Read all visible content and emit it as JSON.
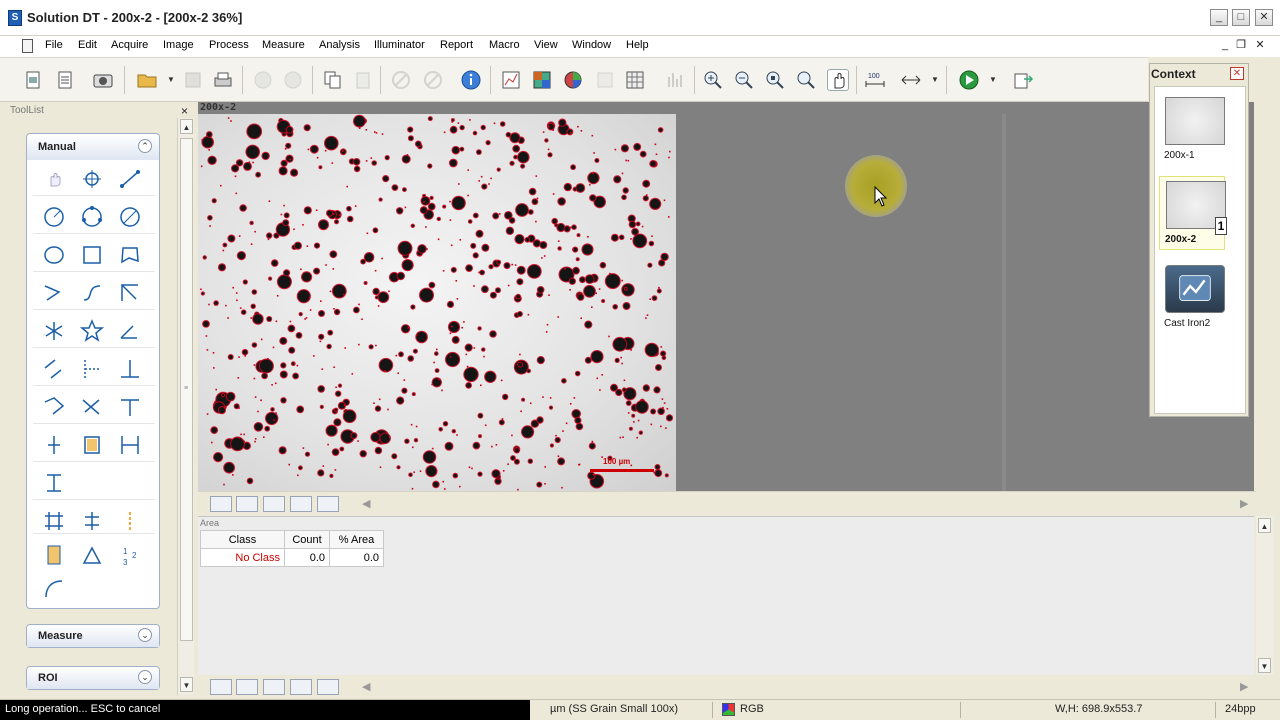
{
  "window": {
    "title": "Solution DT - 200x-2 - [200x-2 36%]",
    "app_icon": "app-logo-icon",
    "controls": {
      "minimize": "_",
      "maximize": "□",
      "close": "✕"
    }
  },
  "menu": {
    "items": [
      "File",
      "Edit",
      "Acquire",
      "Image",
      "Process",
      "Measure",
      "Analysis",
      "Illuminator",
      "Report",
      "Macro",
      "View",
      "Window",
      "Help"
    ],
    "mdi_controls": {
      "minimize": "_",
      "restore": "❐",
      "close": "✕"
    }
  },
  "toolbar": {
    "buttons": [
      "new-image-icon",
      "new-report-icon",
      "camera-icon",
      "open-folder-icon",
      "save-icon",
      "print-icon",
      "undo-icon",
      "redo-icon",
      "copy-icon",
      "paste-icon",
      "cancel-icon",
      "stop-icon",
      "info-icon",
      "image-stats-icon",
      "classify-icon",
      "phase-icon",
      "blank-icon",
      "grid-icon",
      "histogram-icon",
      "zoom-in-icon",
      "zoom-out-icon",
      "zoom-fit-icon",
      "zoom-area-icon",
      "hand-pan-icon",
      "scale-bar-icon",
      "calibration-icon",
      "run-macro-icon",
      "export-icon"
    ]
  },
  "toollist": {
    "title": "ToolList",
    "close": "×",
    "groups": [
      {
        "title": "Manual",
        "expanded": true,
        "chevron": "⌃"
      },
      {
        "title": "Measure",
        "expanded": false,
        "chevron": "⌄"
      },
      {
        "title": "ROI",
        "expanded": false,
        "chevron": "⌄"
      }
    ],
    "tools": [
      "hand-pointer-icon",
      "crosshair-point-icon",
      "line-icon",
      "circle-radius-icon",
      "circle-points-icon",
      "circle-diameter-icon",
      "ellipse-icon",
      "rectangle-icon",
      "polygon-icon",
      "polyline-icon",
      "curve-icon",
      "angle-lines-icon",
      "multi-point-icon",
      "star-icon",
      "angle-icon",
      "parallel-lines-icon",
      "point-distance-icon",
      "perpendicular-icon",
      "four-point-icon",
      "skew-lines-icon",
      "arrow-line-icon",
      "marker-icon",
      "caliper-icon",
      "horizontal-gauge-icon",
      "vertical-gauge-icon",
      "grid-overlay-icon",
      "line-count-icon",
      "vertical-caliper-icon",
      "bracket-icon",
      "triangle-angle-icon",
      "numbered-points-icon",
      "arc-icon"
    ]
  },
  "image": {
    "title": "200x-2",
    "scale_bar_label": "100 µm",
    "zoom_percent": 36,
    "cursor_tool": "circle-brush-cursor"
  },
  "context": {
    "title": "Context",
    "close": "✕",
    "items": [
      {
        "label": "200x-1",
        "selected": false,
        "badge": ""
      },
      {
        "label": "200x-2",
        "selected": true,
        "badge": "1"
      },
      {
        "label": "Cast Iron2",
        "selected": false,
        "badge": ""
      }
    ]
  },
  "data_panel": {
    "title": "Area",
    "columns": [
      "Class",
      "Count",
      "% Area"
    ],
    "rows": [
      {
        "class": "No Class",
        "count": "0.0",
        "area": "0.0"
      }
    ]
  },
  "status": {
    "message": "Long operation... ESC to cancel",
    "calibration": "µm (SS Grain Small 100x)",
    "color_mode": "RGB",
    "dimensions": "W,H: 698.9x553.7",
    "bit_depth": "24bpp"
  },
  "colors": {
    "overlay_red": "#d0021b",
    "particle_dark": "#151515",
    "canvas_gray": "#808080",
    "brush_yellow": "#a8a024"
  }
}
